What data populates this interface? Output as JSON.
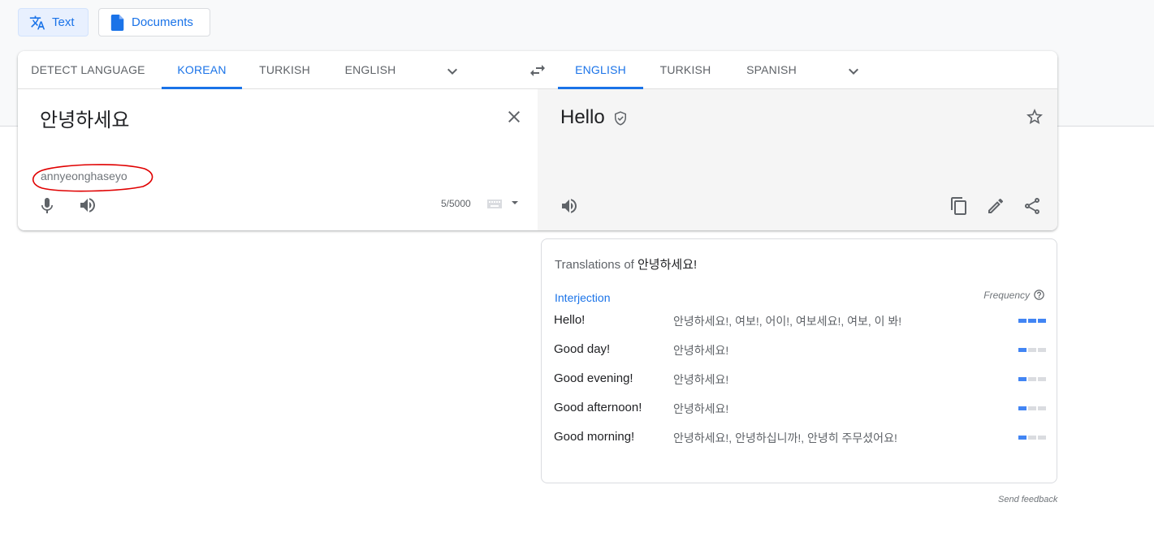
{
  "modes": {
    "text_label": "Text",
    "documents_label": "Documents"
  },
  "source_languages": [
    "DETECT LANGUAGE",
    "KOREAN",
    "TURKISH",
    "ENGLISH"
  ],
  "source_active_index": 1,
  "target_languages": [
    "ENGLISH",
    "TURKISH",
    "SPANISH"
  ],
  "target_active_index": 0,
  "source": {
    "text": "안녕하세요",
    "transliteration": "annyeonghaseyo",
    "char_count": "5/5000"
  },
  "target": {
    "text": "Hello"
  },
  "dictionary": {
    "title_prefix": "Translations of",
    "title_word": "안녕하세요!",
    "part_of_speech": "Interjection",
    "frequency_label": "Frequency",
    "entries": [
      {
        "term": "Hello!",
        "back_translations": "안녕하세요!, 여보!, 어이!, 여보세요!, 여보, 이 봐!",
        "frequency": 3
      },
      {
        "term": "Good day!",
        "back_translations": "안녕하세요!",
        "frequency": 1
      },
      {
        "term": "Good evening!",
        "back_translations": "안녕하세요!",
        "frequency": 1
      },
      {
        "term": "Good afternoon!",
        "back_translations": "안녕하세요!",
        "frequency": 1
      },
      {
        "term": "Good morning!",
        "back_translations": "안녕하세요!, 안녕하십니까!, 안녕히 주무셨어요!",
        "frequency": 1
      }
    ],
    "frequency_max": 3
  },
  "feedback_label": "Send feedback",
  "colors": {
    "accent": "#1a73e8",
    "frequency_on": "#4285f4",
    "frequency_off": "#dadce0",
    "annotation_ring": "#e00000"
  }
}
